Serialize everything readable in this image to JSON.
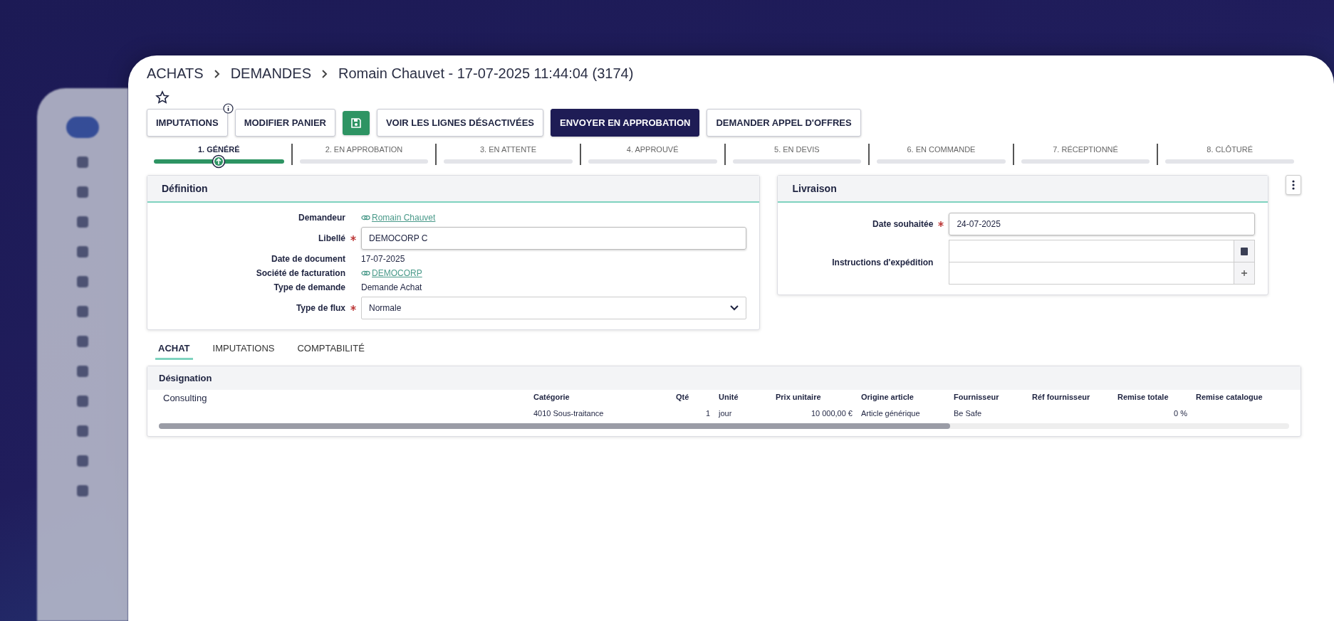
{
  "breadcrumb": [
    "ACHATS",
    "DEMANDES",
    "Romain Chauvet - 17-07-2025 11:44:04 (3174)"
  ],
  "toolbar": [
    {
      "kind": "text",
      "label": "IMPUTATIONS",
      "info": true
    },
    {
      "kind": "text",
      "label": "MODIFIER PANIER",
      "info": false
    },
    {
      "kind": "save"
    },
    {
      "kind": "text",
      "label": "VOIR LES LIGNES DÉSACTIVÉES",
      "info": false
    },
    {
      "kind": "primary",
      "label": "ENVOYER EN APPROBATION"
    },
    {
      "kind": "text",
      "label": "DEMANDER APPEL D'OFFRES",
      "info": false
    }
  ],
  "steps": [
    {
      "label": "1. GÉNÉRÉ",
      "selected": true
    },
    {
      "label": "2. EN APPROBATION",
      "selected": false
    },
    {
      "label": "3. EN ATTENTE",
      "selected": false
    },
    {
      "label": "4. APPROUVÉ",
      "selected": false
    },
    {
      "label": "5. EN DEVIS",
      "selected": false
    },
    {
      "label": "6. EN COMMANDE",
      "selected": false
    },
    {
      "label": "7. RÉCEPTIONNÉ",
      "selected": false
    },
    {
      "label": "8. CLÔTURÉ",
      "selected": false
    }
  ],
  "definition": {
    "title": "Définition",
    "fields": [
      {
        "kind": "link",
        "label": "Demandeur",
        "required": false,
        "value": "Romain Chauvet"
      },
      {
        "kind": "input",
        "label": "Libellé",
        "required": true,
        "value": "DEMOCORP C"
      },
      {
        "kind": "text",
        "label": "Date de document",
        "required": false,
        "value": "17-07-2025"
      },
      {
        "kind": "link",
        "label": "Société de facturation",
        "required": false,
        "value": "DEMOCORP"
      },
      {
        "kind": "text",
        "label": "Type de demande",
        "required": false,
        "value": "Demande Achat"
      },
      {
        "kind": "select",
        "label": "Type de flux",
        "required": true,
        "value": "Normale"
      }
    ]
  },
  "livraison": {
    "title": "Livraison",
    "fields": [
      {
        "kind": "input",
        "label": "Date souhaitée",
        "required": true,
        "value": "24-07-2025"
      },
      {
        "kind": "textarea",
        "label": "Instructions d'expédition",
        "required": false
      }
    ]
  },
  "tabs": [
    {
      "label": "ACHAT",
      "selected": true
    },
    {
      "label": "IMPUTATIONS",
      "selected": false
    },
    {
      "label": "COMPTABILITÉ",
      "selected": false
    }
  ],
  "table": {
    "section": "Désignation",
    "designation": "Consulting",
    "columns": [
      "Catégorie",
      "Qté",
      "Unité",
      "Prix unitaire",
      "Origine article",
      "Fournisseur",
      "Réf fournisseur",
      "Remise totale",
      "Remise catalogue"
    ],
    "rows": [
      {
        "cells": [
          "4010 Sous-traitance",
          "1",
          "jour",
          "10 000,00 €",
          "Article générique",
          "Be Safe",
          null,
          "0 %",
          null
        ]
      }
    ]
  }
}
